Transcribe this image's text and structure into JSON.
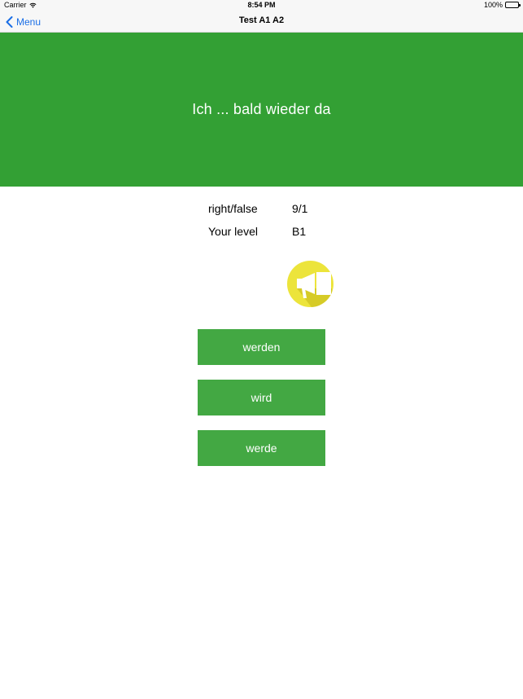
{
  "status_bar": {
    "carrier": "Carrier",
    "time": "8:54 PM",
    "battery": "100%"
  },
  "nav": {
    "back_label": "Menu",
    "title": "Test A1 A2"
  },
  "question": {
    "text": "Ich ... bald wieder da"
  },
  "stats": {
    "right_false_label": "right/false",
    "right_false_value": "9/1",
    "level_label": "Your level",
    "level_value": "B1"
  },
  "speaker": {
    "icon": "megaphone-icon"
  },
  "answers": [
    {
      "label": "werden"
    },
    {
      "label": "wird"
    },
    {
      "label": "werde"
    }
  ],
  "colors": {
    "question_bg": "#33a034",
    "answer_bg": "#43a843",
    "speaker_bg": "#ece43b",
    "link": "#1a6ee6"
  }
}
